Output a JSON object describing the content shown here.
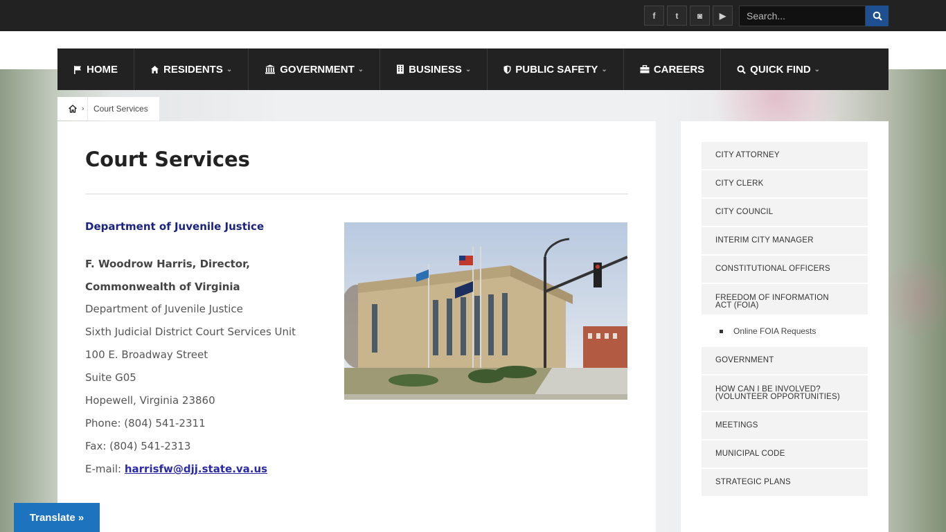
{
  "topbar": {
    "social": [
      {
        "name": "facebook-icon",
        "glyph": "f"
      },
      {
        "name": "twitter-icon",
        "glyph": "t"
      },
      {
        "name": "instagram-icon",
        "glyph": "◙"
      },
      {
        "name": "youtube-icon",
        "glyph": "▶"
      }
    ],
    "search_placeholder": "Search..."
  },
  "nav": {
    "items": [
      {
        "label": "HOME",
        "icon": "flag-icon",
        "dropdown": false
      },
      {
        "label": "RESIDENTS",
        "icon": "house-icon",
        "dropdown": true
      },
      {
        "label": "GOVERNMENT",
        "icon": "institution-icon",
        "dropdown": true
      },
      {
        "label": "BUSINESS",
        "icon": "building-icon",
        "dropdown": true
      },
      {
        "label": "PUBLIC SAFETY",
        "icon": "shield-icon",
        "dropdown": true
      },
      {
        "label": "CAREERS",
        "icon": "briefcase-icon",
        "dropdown": false
      },
      {
        "label": "QUICK FIND",
        "icon": "search-icon",
        "dropdown": true
      }
    ]
  },
  "breadcrumb": {
    "current": "Court Services"
  },
  "main": {
    "title": "Court Services",
    "dept_heading": "Department of Juvenile Justice",
    "director": "F. Woodrow Harris, Director, Commonwealth of Virginia",
    "address_lines": [
      "Department of Juvenile Justice",
      "Sixth Judicial District Court Services Unit",
      "100 E. Broadway Street",
      "Suite G05",
      "Hopewell, Virginia 23860",
      "Phone: (804) 541-2311",
      "Fax: (804) 541-2313"
    ],
    "email_label": "E-mail: ",
    "email": "harrisfw@djj.state.va.us"
  },
  "sidebar": {
    "items": [
      "CITY ATTORNEY",
      "CITY CLERK",
      "CITY COUNCIL",
      "INTERIM CITY MANAGER",
      "CONSTITUTIONAL OFFICERS",
      "FREEDOM OF INFORMATION ACT (FOIA)"
    ],
    "sub_item": "Online FOIA Requests",
    "items_after": [
      "GOVERNMENT",
      "HOW CAN I BE INVOLVED? (VOLUNTEER OPPORTUNITIES)",
      "MEETINGS",
      "MUNICIPAL CODE",
      "STRATEGIC PLANS"
    ]
  },
  "translate_label": "Translate »",
  "colors": {
    "nav_bg": "#222222",
    "accent_blue": "#1d4f91",
    "heading_blue": "#1a237e",
    "translate_blue": "#1e73be"
  }
}
